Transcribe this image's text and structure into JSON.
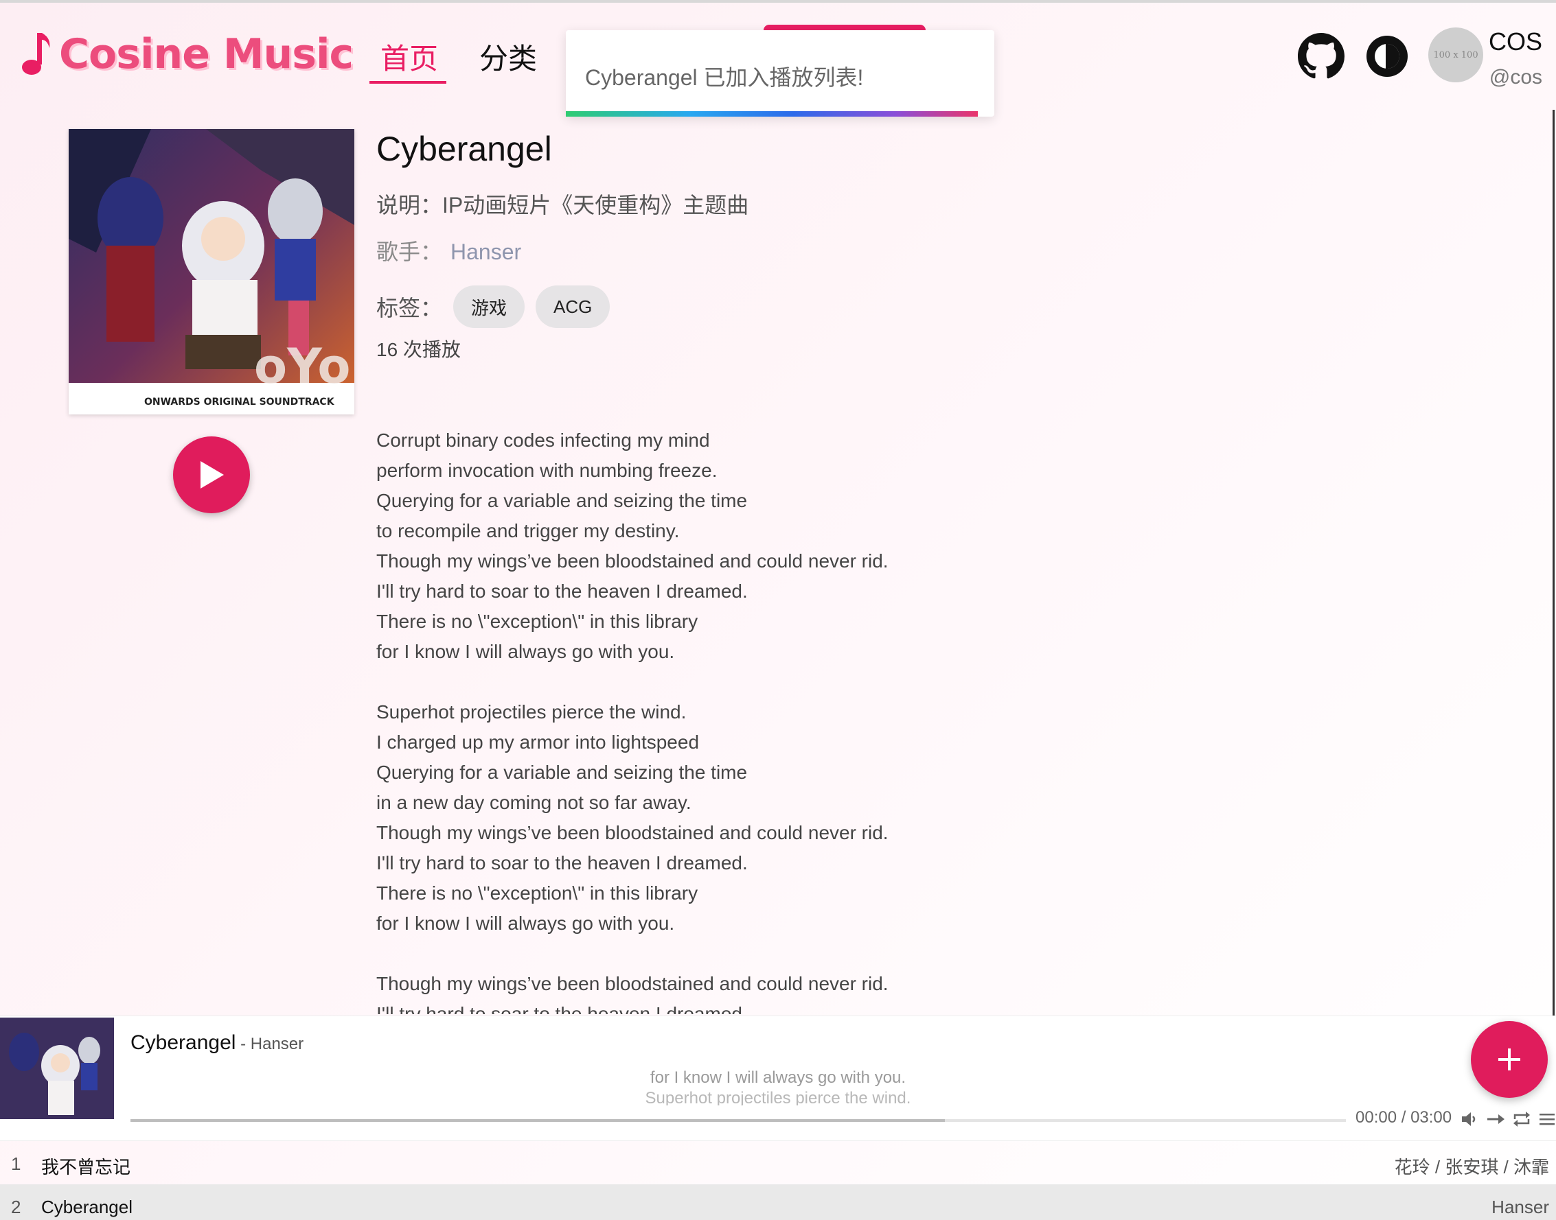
{
  "header": {
    "logo_text": "Cosine Music",
    "nav": [
      {
        "label": "首页",
        "active": true
      },
      {
        "label": "分类",
        "active": false
      }
    ],
    "toast": "Cyberangel 已加入播放列表!",
    "icons": [
      "github-icon",
      "theme-toggle-icon"
    ],
    "avatar_placeholder": "100 x 100",
    "user_name": "COS",
    "user_handle": "@cos"
  },
  "song": {
    "title": "Cyberangel",
    "description_label": "说明：",
    "description": "IP动画短片《天使重构》主题曲",
    "singer_label": "歌手：",
    "singer": "Hanser",
    "tags_label": "标签：",
    "tags": [
      "游戏",
      "ACG"
    ],
    "plays": "16 次播放",
    "cover_text": "ONWARDS ORIGINAL SOUNDTRACK"
  },
  "lyrics": [
    "Corrupt binary codes infecting my mind",
    "perform invocation with numbing freeze.",
    "Querying for a variable and seizing the time",
    "to recompile and trigger my destiny.",
    "Though my wings’ve been bloodstained and could never rid.",
    "I'll try hard to soar to the heaven I dreamed.",
    "There is no \\\"exception\\\" in this library",
    "for I know I will always go with you.",
    "",
    "Superhot projectiles pierce the wind.",
    "I charged up my armor into lightspeed",
    "Querying for a variable and seizing the time",
    "in a new day coming not so far away.",
    "Though my wings’ve been bloodstained and could never rid.",
    "I'll try hard to soar to the heaven I dreamed.",
    "There is no \\\"exception\\\" in this library",
    "for I know I will always go with you.",
    "",
    "Though my wings’ve been bloodstained and could never rid.",
    "I'll try hard to soar to the heaven I dreamed."
  ],
  "player": {
    "title": "Cyberangel",
    "artist": " - Hanser",
    "lyric_current": "for I know I will always go with you.",
    "lyric_next": "Superhot projectiles pierce the wind.",
    "time": "00:00 / 03:00",
    "progress": 0.0,
    "buffered": 0.67
  },
  "playlist": [
    {
      "index": "1",
      "name": "我不曾忘记",
      "artist": "花玲 / 张安琪 / 沐霏",
      "current": false
    },
    {
      "index": "2",
      "name": "Cyberangel",
      "artist": "Hanser",
      "current": true
    }
  ],
  "colors": {
    "accent": "#e91e63",
    "logo": "#ec4d7d"
  }
}
